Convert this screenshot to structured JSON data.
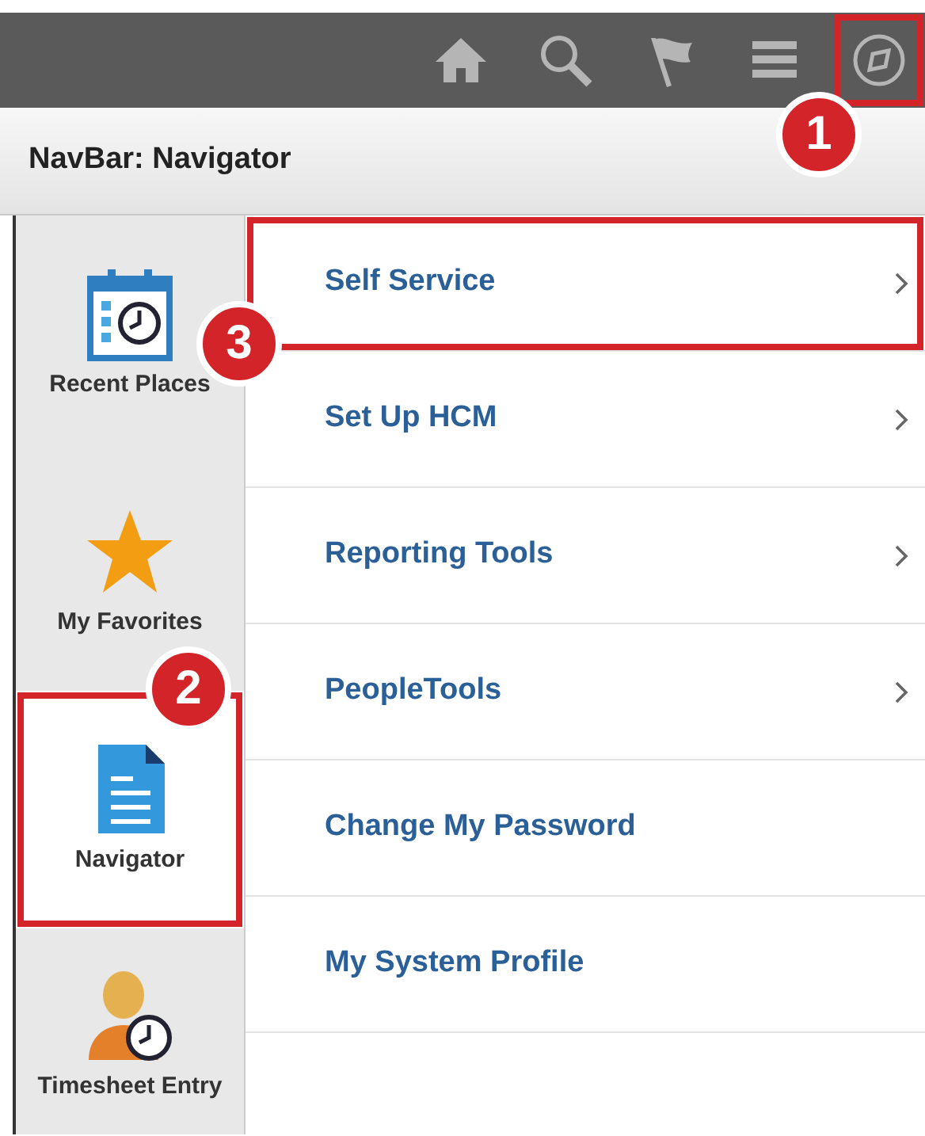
{
  "toolbar": {
    "buttons": [
      {
        "kind": "home"
      },
      {
        "kind": "search"
      },
      {
        "kind": "flag"
      },
      {
        "kind": "menu"
      },
      {
        "kind": "navigator",
        "callout": "1"
      }
    ]
  },
  "header": {
    "title": "NavBar: Navigator"
  },
  "sidebar": {
    "items": [
      {
        "label": "Recent Places",
        "kind": "recent",
        "selected": false
      },
      {
        "label": "My Favorites",
        "kind": "favorites",
        "selected": false
      },
      {
        "label": "Navigator",
        "kind": "navigator",
        "selected": true,
        "callout": "2"
      },
      {
        "label": "Timesheet Entry",
        "kind": "timesheet",
        "selected": false
      }
    ]
  },
  "menu": {
    "items": [
      {
        "label": "Self Service",
        "has_submenu": true,
        "callout": "3"
      },
      {
        "label": "Set Up HCM",
        "has_submenu": true
      },
      {
        "label": "Reporting Tools",
        "has_submenu": true
      },
      {
        "label": "PeopleTools",
        "has_submenu": true
      },
      {
        "label": "Change My Password",
        "has_submenu": false
      },
      {
        "label": "My System Profile",
        "has_submenu": false
      }
    ]
  }
}
